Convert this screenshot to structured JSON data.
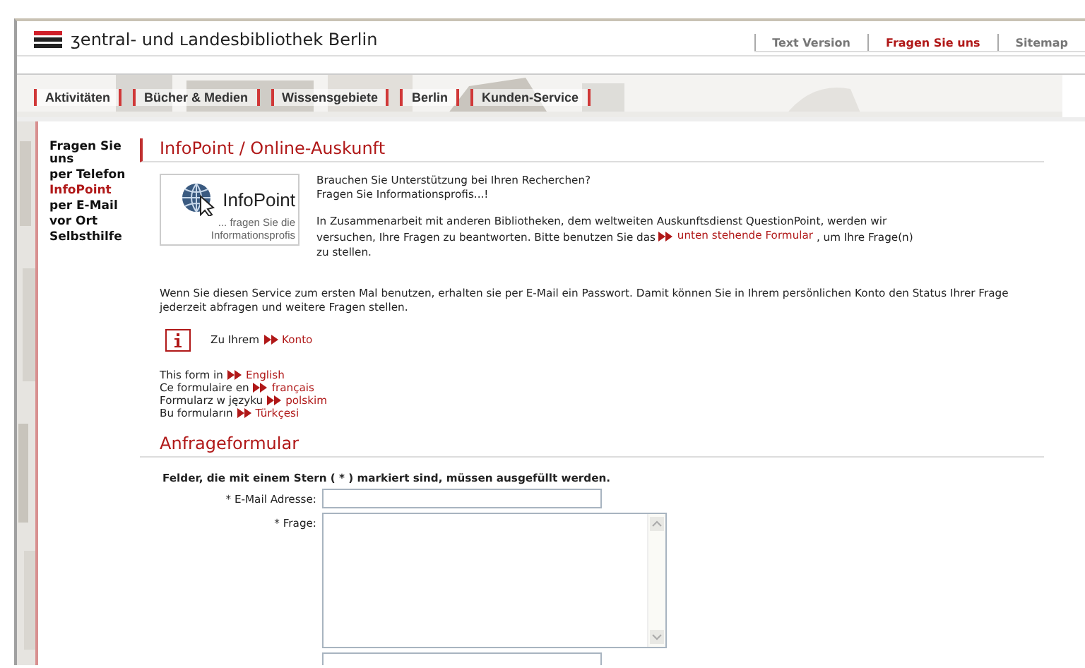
{
  "site": {
    "title": "ʒentral- und ʟandesbibliothek Berlin"
  },
  "top_links": [
    {
      "label": "Text Version",
      "selected": false
    },
    {
      "label": "Fragen Sie uns",
      "selected": true
    },
    {
      "label": "Sitemap",
      "selected": false
    }
  ],
  "nav": [
    {
      "label": "Aktivitäten"
    },
    {
      "label": "Bücher & Medien"
    },
    {
      "label": "Wissensgebiete"
    },
    {
      "label": "Berlin"
    },
    {
      "label": "Kunden-Service"
    }
  ],
  "sidebar": {
    "items": [
      {
        "label": "Fragen Sie uns",
        "selected": false
      },
      {
        "label": "per Telefon",
        "selected": false
      },
      {
        "label": "InfoPoint",
        "selected": true
      },
      {
        "label": "per E-Mail",
        "selected": false
      },
      {
        "label": "vor Ort",
        "selected": false
      },
      {
        "label": "Selbsthilfe",
        "selected": false
      }
    ]
  },
  "page_title": "InfoPoint / Online-Auskunft",
  "logo": {
    "name": "InfoPoint",
    "tagline": "... fragen Sie die Informationsprofis"
  },
  "intro": "Brauchen Sie Unterstützung bei Ihren Recherchen?\nFragen Sie Informationsprofis...!",
  "cooperation": {
    "before": "In Zusammenarbeit mit anderen Bibliotheken, dem weltweiten Auskunftsdienst QuestionPoint, werden wir versuchen, Ihre Fragen zu beantworten. Bitte benutzen Sie das",
    "link": "unten stehende Formular",
    "after": ", um Ihre Frage(n) zu stellen."
  },
  "account_note": "Wenn Sie diesen Service zum ersten Mal benutzen, erhalten sie per E-Mail ein Passwort. Damit können Sie in Ihrem persönlichen Konto den Status Ihrer Frage jederzeit abfragen und weitere Fragen stellen.",
  "account_link": {
    "text": "Zu Ihrem",
    "link": "Konto"
  },
  "languages": [
    {
      "text": "This form in",
      "link": "English"
    },
    {
      "text": "Ce formulaire en",
      "link": "français"
    },
    {
      "text": "Formularz w języku",
      "link": "polskim"
    },
    {
      "text": "Bu formuların",
      "link": "Türkçesi"
    }
  ],
  "form": {
    "title": "Anfrageformular",
    "note": "Felder, die mit einem Stern ( * ) markiert sind, müssen ausgefüllt werden.",
    "fields": [
      {
        "kind": "input",
        "label": "* E-Mail Adresse:"
      },
      {
        "kind": "textarea",
        "label": "* Frage:"
      },
      {
        "kind": "input"
      }
    ]
  }
}
